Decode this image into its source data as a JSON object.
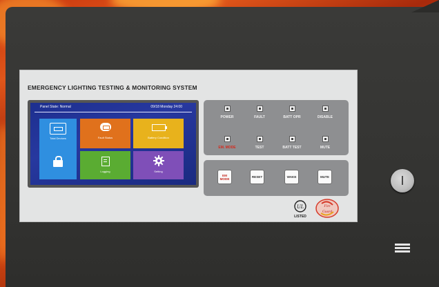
{
  "panel": {
    "title": "EMERGENCY LIGHTING TESTING & MONITORING SYSTEM",
    "status_text": "Panel State: Normal",
    "datetime_text": "09/18 Monday 24:00"
  },
  "tiles": [
    {
      "label": "Total Devices",
      "icon": "devices-icon",
      "color": "#2f8fe0"
    },
    {
      "label": "Fault Status",
      "icon": "fault-status-icon",
      "color": "#e0711c"
    },
    {
      "label": "Battery Condition",
      "icon": "battery-icon",
      "color": "#e8b21c"
    },
    {
      "label": "Logging",
      "icon": "logging-icon",
      "color": "#5aac32"
    },
    {
      "label": "Setting",
      "icon": "gear-icon",
      "color": "#7f4fb8"
    },
    {
      "label": "",
      "icon": "lock-icon",
      "color": "#2f8fe0"
    }
  ],
  "indicators": [
    {
      "label": "POWER",
      "color": "#f2f2f2"
    },
    {
      "label": "FAULT",
      "color": "#f2f2f2"
    },
    {
      "label": "BATT OPR",
      "color": "#f2f2f2"
    },
    {
      "label": "DISABLE",
      "color": "#f2f2f2"
    },
    {
      "label": "EM. MODE",
      "color": "#d42a1e"
    },
    {
      "label": "TEST",
      "color": "#f2f2f2"
    },
    {
      "label": "BATT TEST",
      "color": "#f2f2f2"
    },
    {
      "label": "MUTE",
      "color": "#f2f2f2"
    }
  ],
  "buttons": [
    {
      "label": "EM MODE",
      "color": "#c4281d"
    },
    {
      "label": "RESET",
      "color": "#333333"
    },
    {
      "label": "WAKE",
      "color": "#333333"
    },
    {
      "label": "MUTE",
      "color": "#333333"
    }
  ],
  "logos": {
    "ul": "UL LISTED",
    "brand": "Fire Guard"
  }
}
